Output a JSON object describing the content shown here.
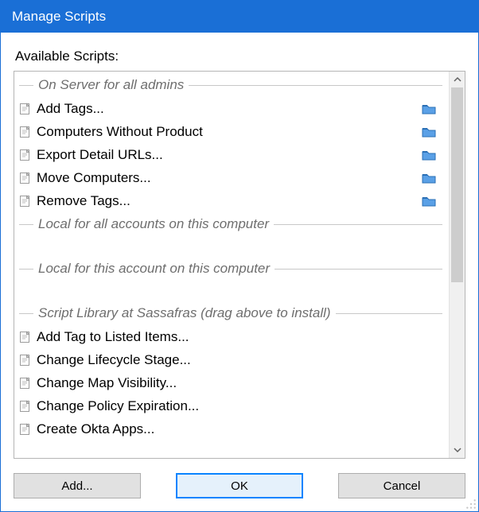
{
  "window": {
    "title": "Manage Scripts"
  },
  "labels": {
    "available": "Available Scripts:"
  },
  "groups": {
    "server": {
      "label": "On Server for all admins"
    },
    "localAll": {
      "label": "Local for all accounts on this computer"
    },
    "localThis": {
      "label": "Local for this account on this computer"
    },
    "library": {
      "label": "Script Library at Sassafras (drag above to install)"
    }
  },
  "scripts": {
    "server": [
      {
        "name": "Add Tags...",
        "hasFolder": true
      },
      {
        "name": "Computers Without Product",
        "hasFolder": true
      },
      {
        "name": "Export Detail URLs...",
        "hasFolder": true
      },
      {
        "name": "Move Computers...",
        "hasFolder": true
      },
      {
        "name": "Remove Tags...",
        "hasFolder": true
      }
    ],
    "library": [
      {
        "name": "Add Tag to Listed Items...",
        "hasFolder": false
      },
      {
        "name": "Change Lifecycle Stage...",
        "hasFolder": false
      },
      {
        "name": "Change Map Visibility...",
        "hasFolder": false
      },
      {
        "name": "Change Policy Expiration...",
        "hasFolder": false
      },
      {
        "name": "Create Okta Apps...",
        "hasFolder": false
      }
    ]
  },
  "buttons": {
    "add": "Add...",
    "ok": "OK",
    "cancel": "Cancel"
  }
}
